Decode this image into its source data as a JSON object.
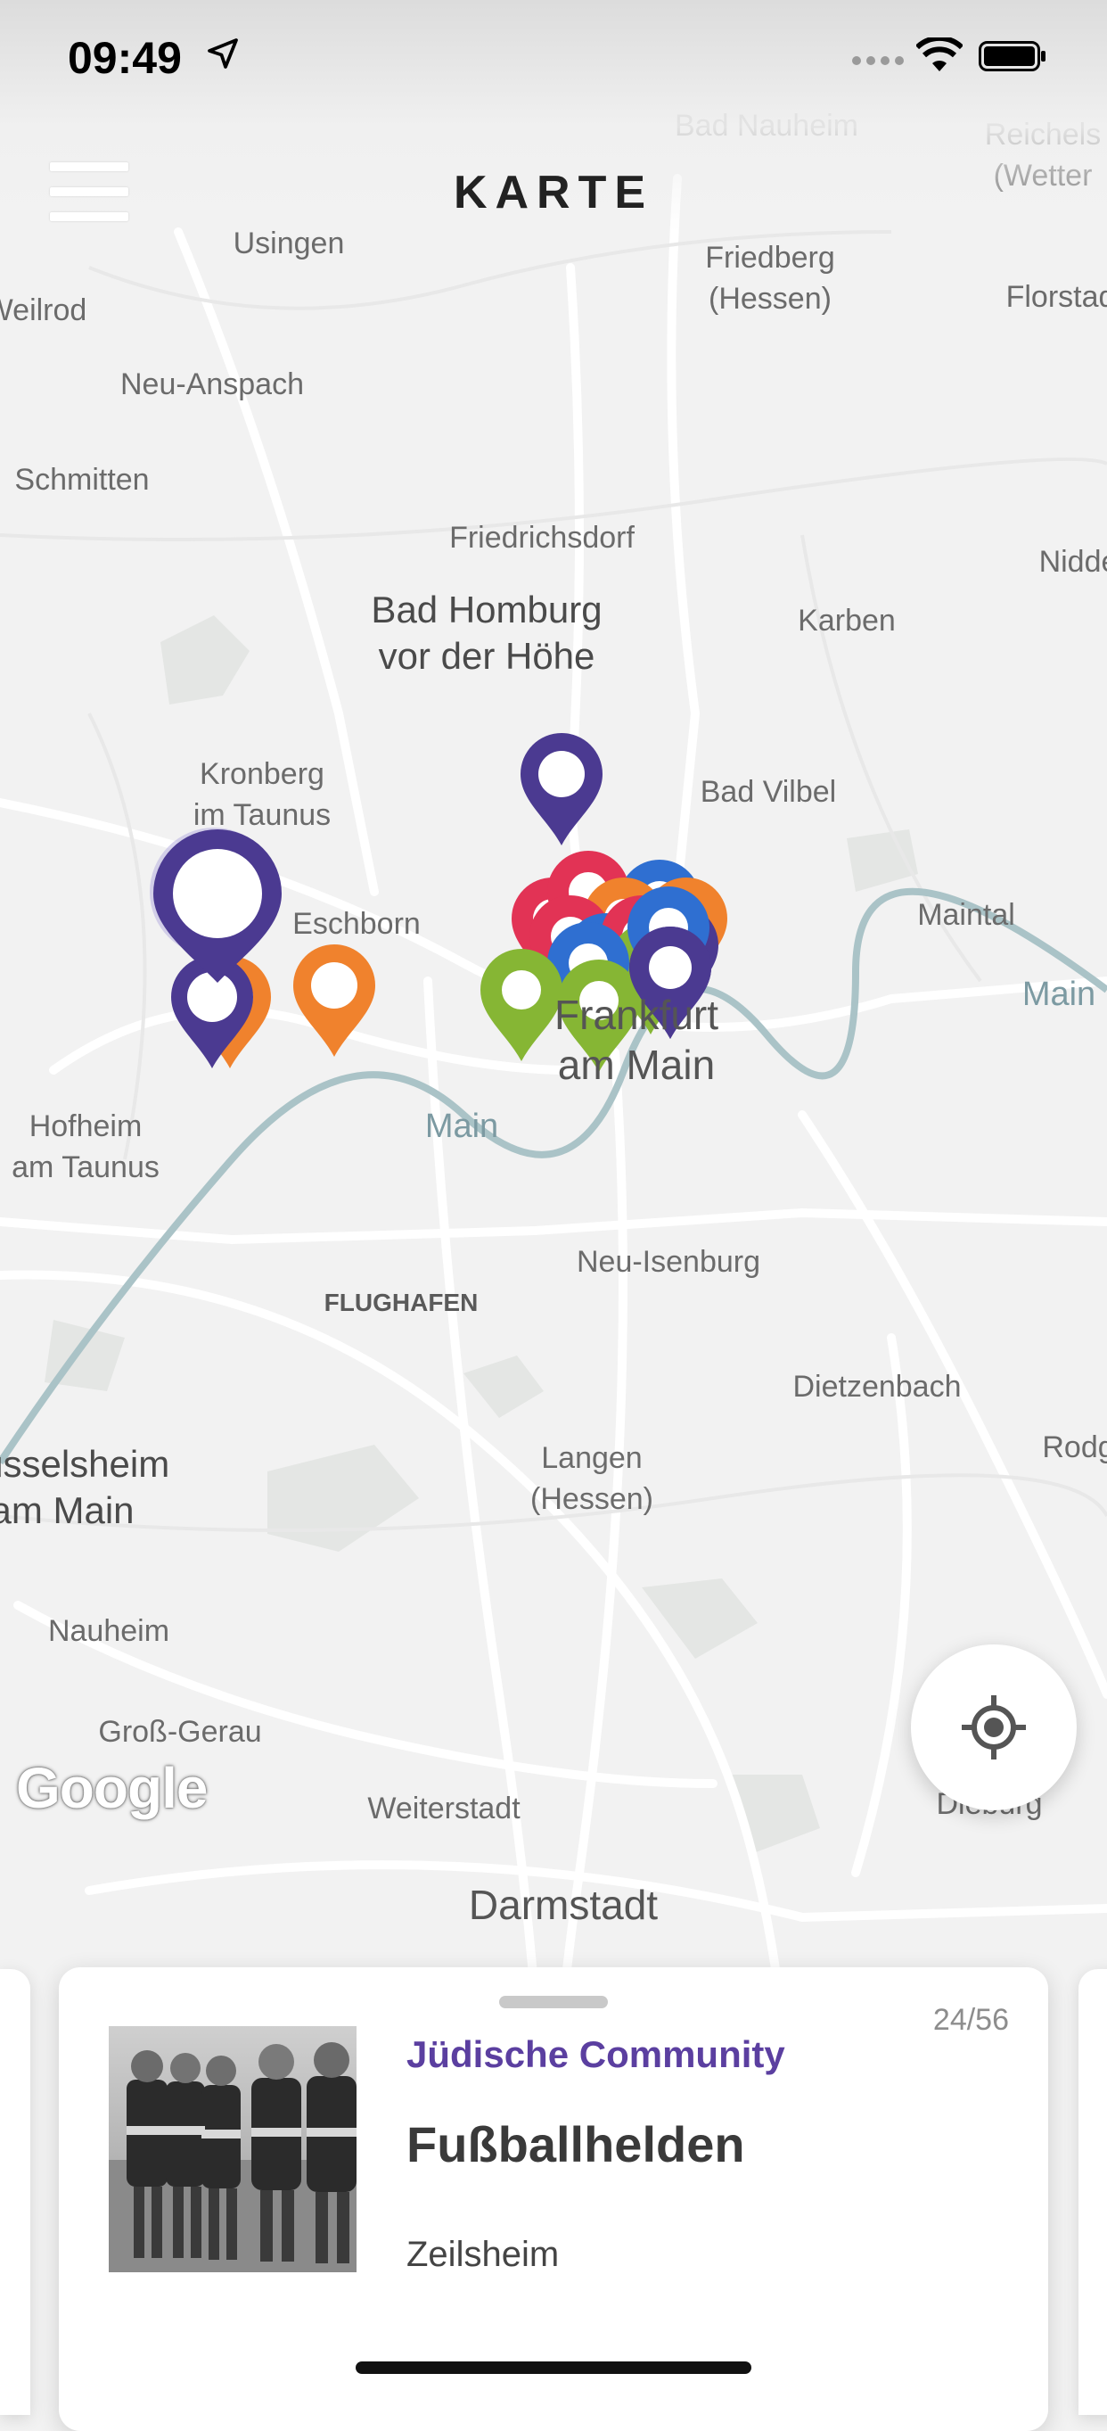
{
  "status_bar": {
    "time": "09:49"
  },
  "header": {
    "title": "KARTE"
  },
  "map": {
    "attribution": "Google",
    "labels": [
      {
        "text": "Bad Nauheim",
        "cls": ""
      },
      {
        "text": "Reichels\n(Wetter",
        "cls": ""
      },
      {
        "text": "Usingen",
        "cls": ""
      },
      {
        "text": "Friedberg\n(Hessen)",
        "cls": ""
      },
      {
        "text": "Florstad",
        "cls": ""
      },
      {
        "text": "Weilrod",
        "cls": ""
      },
      {
        "text": "Neu-Anspach",
        "cls": ""
      },
      {
        "text": "Schmitten",
        "cls": ""
      },
      {
        "text": "Friedrichsdorf",
        "cls": ""
      },
      {
        "text": "Nidde",
        "cls": ""
      },
      {
        "text": "Bad Homburg\nvor der Höhe",
        "cls": "big"
      },
      {
        "text": "Karben",
        "cls": ""
      },
      {
        "text": "Kronberg\nim Taunus",
        "cls": ""
      },
      {
        "text": "Bad Vilbel",
        "cls": ""
      },
      {
        "text": "Eschborn",
        "cls": ""
      },
      {
        "text": "Maintal",
        "cls": ""
      },
      {
        "text": "Main",
        "cls": "river"
      },
      {
        "text": "Frankfurt\nam Main",
        "cls": "xl"
      },
      {
        "text": "Main",
        "cls": "river"
      },
      {
        "text": "Hofheim\nam Taunus",
        "cls": ""
      },
      {
        "text": "Neu-Isenburg",
        "cls": ""
      },
      {
        "text": "FLUGHAFEN",
        "cls": "small"
      },
      {
        "text": "Dietzenbach",
        "cls": ""
      },
      {
        "text": "Rüsselsheim\nam Main",
        "cls": "big"
      },
      {
        "text": "Rodg",
        "cls": ""
      },
      {
        "text": "Langen\n(Hessen)",
        "cls": ""
      },
      {
        "text": "Nauheim",
        "cls": ""
      },
      {
        "text": "Groß-Gerau",
        "cls": ""
      },
      {
        "text": "Weiterstadt",
        "cls": ""
      },
      {
        "text": "Dieburg",
        "cls": ""
      },
      {
        "text": "Darmstadt",
        "cls": "xl"
      }
    ],
    "colors": {
      "purple": "#4b3a91",
      "orange": "#f0822d",
      "green": "#86b634",
      "red": "#e23355",
      "blue": "#2f6fd1"
    }
  },
  "card": {
    "counter": "24/56",
    "category": "Jüdische Community",
    "title": "Fußballhelden",
    "location": "Zeilsheim"
  }
}
